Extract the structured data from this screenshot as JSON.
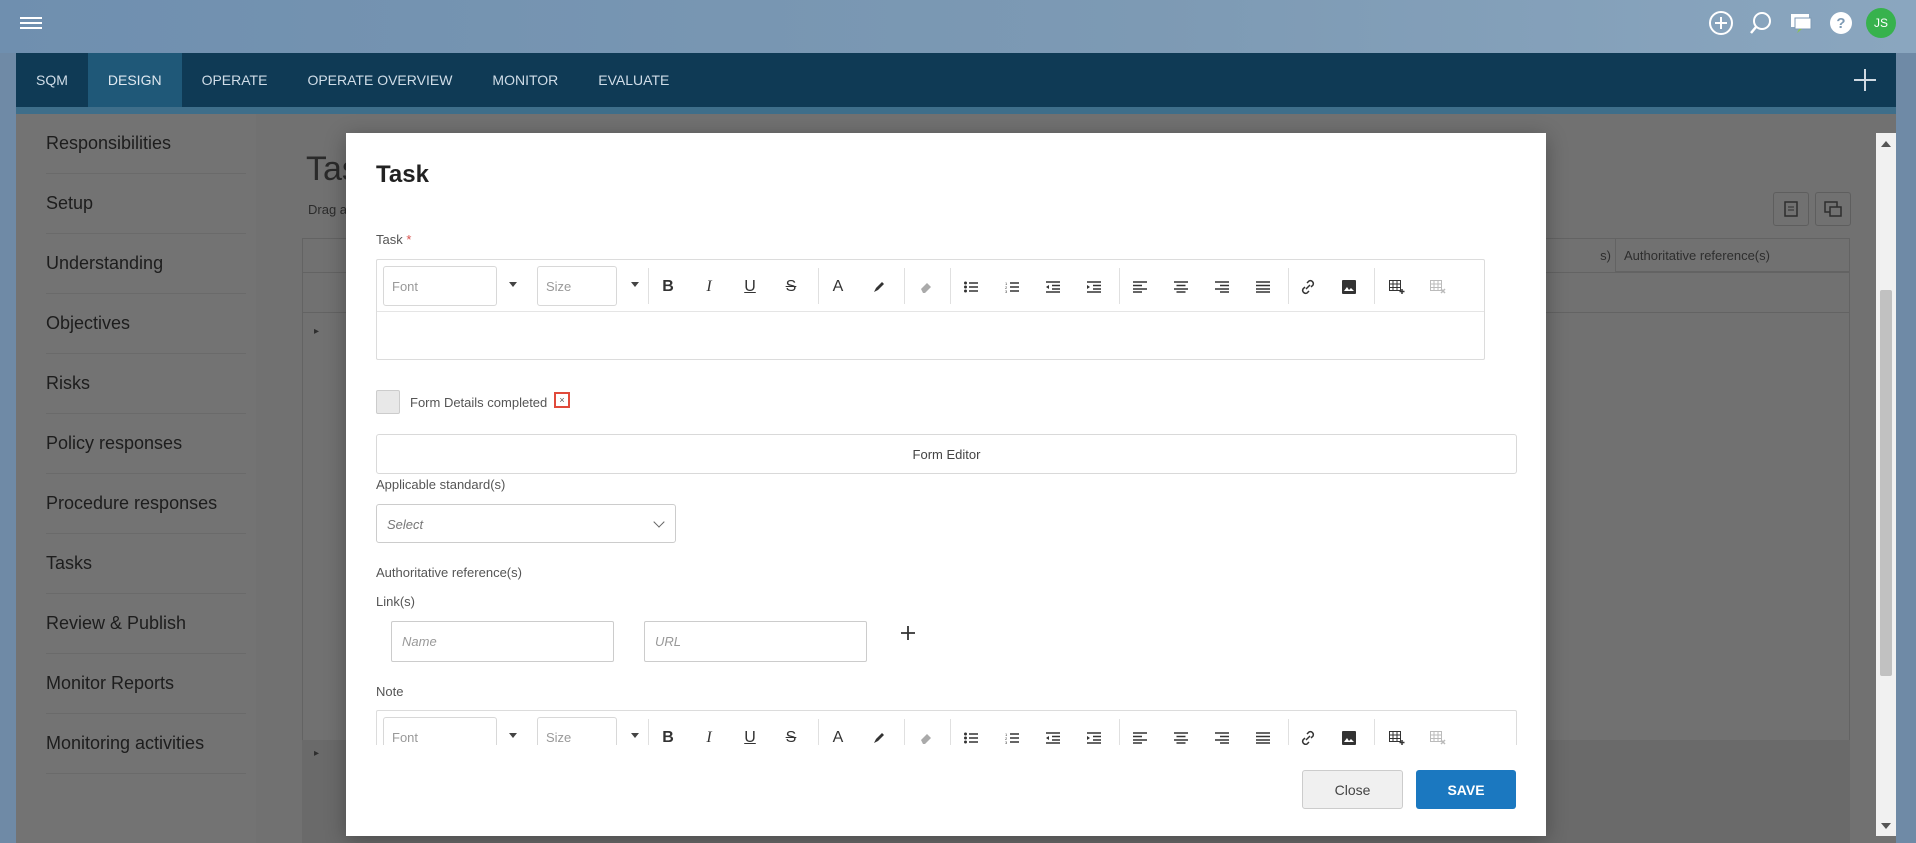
{
  "topbar": {
    "avatar_initials": "JS",
    "icons": [
      "add-circle-icon",
      "search-icon",
      "chat-icon",
      "help-icon"
    ],
    "avatar_color": "#37b24d"
  },
  "nav": {
    "tabs": [
      {
        "label": "SQM",
        "active": false
      },
      {
        "label": "DESIGN",
        "active": true
      },
      {
        "label": "OPERATE",
        "active": false
      },
      {
        "label": "OPERATE OVERVIEW",
        "active": false
      },
      {
        "label": "MONITOR",
        "active": false
      },
      {
        "label": "EVALUATE",
        "active": false
      }
    ],
    "background": "#0f3a55"
  },
  "sidebar": {
    "items": [
      {
        "label": "Responsibilities"
      },
      {
        "label": "Setup"
      },
      {
        "label": "Understanding"
      },
      {
        "label": "Objectives"
      },
      {
        "label": "Risks"
      },
      {
        "label": "Policy responses"
      },
      {
        "label": "Procedure responses"
      },
      {
        "label": "Tasks"
      },
      {
        "label": "Review & Publish"
      },
      {
        "label": "Monitor Reports"
      },
      {
        "label": "Monitoring activities"
      }
    ]
  },
  "background_page": {
    "title": "Tas",
    "drag_hint": "Drag a",
    "column_header": "Authoritative reference(s)",
    "column_header_partial": "s)"
  },
  "modal": {
    "title": "Task",
    "task_label": "Task",
    "required_mark": "*",
    "font_placeholder": "Font",
    "size_placeholder": "Size",
    "checkbox_label": "Form Details completed",
    "checkbox_clear": "×",
    "form_editor_button": "Form Editor",
    "applicable_standards_label": "Applicable standard(s)",
    "applicable_standards_select": "Select",
    "authoritative_label": "Authoritative reference(s)",
    "links_label": "Link(s)",
    "link_name_placeholder": "Name",
    "link_url_placeholder": "URL",
    "note_label": "Note",
    "close_button": "Close",
    "save_button": "SAVE",
    "save_color": "#1b78c0"
  }
}
